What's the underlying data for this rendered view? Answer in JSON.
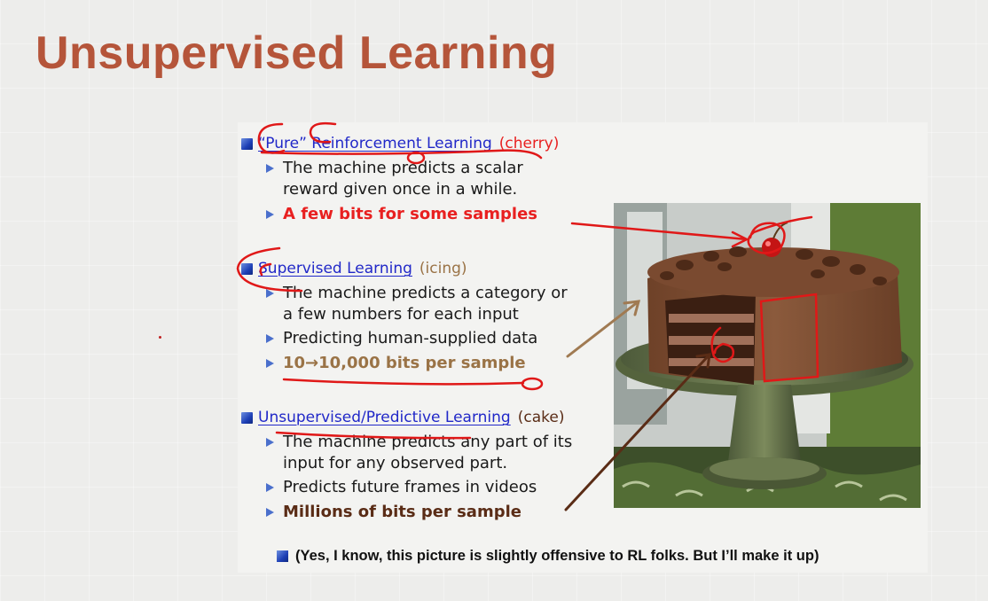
{
  "title": "Unsupervised Learning",
  "sections": [
    {
      "heading": "“Pure” Reinforcement Learning",
      "paren": "(cherry)",
      "bullets": [
        "The machine predicts a scalar reward given once in a while.",
        "A few bits for some samples"
      ]
    },
    {
      "heading": "Supervised Learning",
      "paren": "(icing)",
      "bullets": [
        "The machine predicts a category or a few numbers for each input",
        "Predicting human-supplied data",
        "10→10,000 bits per sample"
      ]
    },
    {
      "heading": "Unsupervised/Predictive Learning",
      "paren": "(cake)",
      "bullets": [
        "The machine predicts any part of its input for any observed part.",
        "Predicts future frames in videos",
        "Millions of bits per sample"
      ]
    }
  ],
  "footer": "(Yes, I know, this picture is slightly offensive to RL folks. But I’ll make it up)",
  "colors": {
    "title": "#b5553a",
    "heading_link": "#2128c8",
    "cherry_paren": "#e82020",
    "icing_paren": "#9a7346",
    "cake_paren": "#5a2c16",
    "annotation": "#e01818"
  },
  "image": {
    "subject": "chocolate layer cake on green cake stand with cherry on top"
  }
}
